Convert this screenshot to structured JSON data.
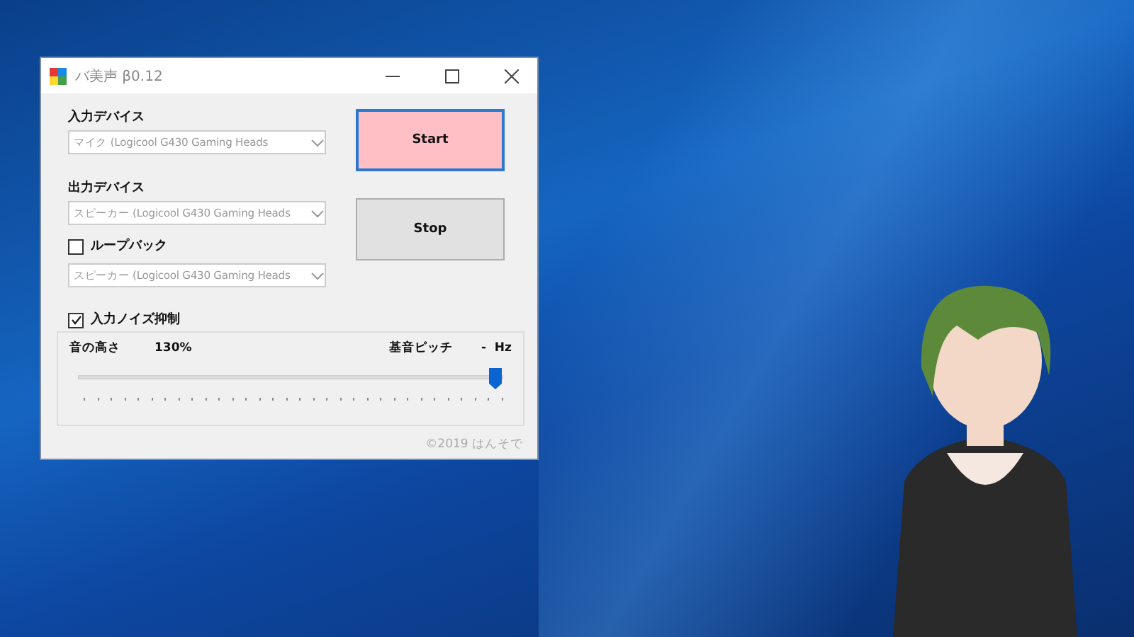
{
  "window": {
    "title": "バ美声 β0.12"
  },
  "input_device": {
    "label": "入力デバイス",
    "value": "マイク (Logicool G430 Gaming Heads"
  },
  "output_device": {
    "label": "出力デバイス",
    "value": "スピーカー (Logicool G430 Gaming Heads"
  },
  "loopback": {
    "label": "ループバック",
    "checked": false,
    "value": "スピーカー (Logicool G430 Gaming Heads"
  },
  "noise_suppression": {
    "label": "入力ノイズ抑制",
    "checked": true
  },
  "buttons": [
    {
      "label": "Start",
      "kind": "primary"
    },
    {
      "label": "Stop",
      "kind": "normal"
    }
  ],
  "pitch": {
    "label": "音の高さ",
    "reading": "130%",
    "base_label": "基音ピッチ",
    "base_reading": "-  Hz",
    "level": 0.98
  },
  "footer": "©2019  はんそで"
}
